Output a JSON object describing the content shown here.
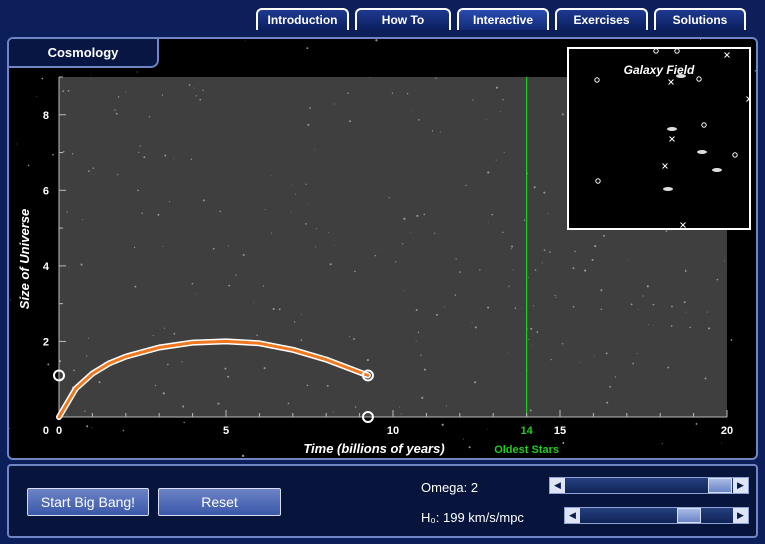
{
  "tabs": [
    {
      "label": "Introduction",
      "active": false
    },
    {
      "label": "How To",
      "active": false
    },
    {
      "label": "Interactive",
      "active": true
    },
    {
      "label": "Exercises",
      "active": false
    },
    {
      "label": "Solutions",
      "active": false
    }
  ],
  "panel": {
    "title": "Cosmology"
  },
  "galaxy_field": {
    "title": "Galaxy Field"
  },
  "controls": {
    "start_label": "Start Big Bang!",
    "reset_label": "Reset",
    "omega_label": "Omega: 2",
    "omega_value": 2,
    "h0_label": "H₀: 199 km/s/mpc",
    "h0_value": 199
  },
  "chart_data": {
    "type": "line",
    "xlabel": "Time (billions of years)",
    "ylabel": "Size of Universe",
    "xlim": [
      0,
      20
    ],
    "ylim": [
      0,
      9
    ],
    "x_ticks": [
      0,
      5,
      10,
      15,
      20
    ],
    "y_ticks": [
      2,
      4,
      6,
      8
    ],
    "series": [
      {
        "x": [
          0,
          0.5,
          1,
          1.5,
          2,
          3,
          4,
          5,
          6,
          7,
          8,
          9.25
        ],
        "y": [
          0,
          0.75,
          1.15,
          1.42,
          1.6,
          1.84,
          1.97,
          2.0,
          1.95,
          1.78,
          1.52,
          1.1
        ]
      }
    ],
    "markers": [
      {
        "x": 0,
        "y": 1.1
      },
      {
        "x": 9.25,
        "y": 1.1
      },
      {
        "x": 9.25,
        "y": 0
      }
    ],
    "oldest_stars": {
      "x": 14,
      "label": "Oldest Stars",
      "tick_label": "14"
    },
    "colors": {
      "curve": "#f07820",
      "oldest_stars": "#22cc22",
      "plot_bg": "#3f3f3f"
    }
  }
}
